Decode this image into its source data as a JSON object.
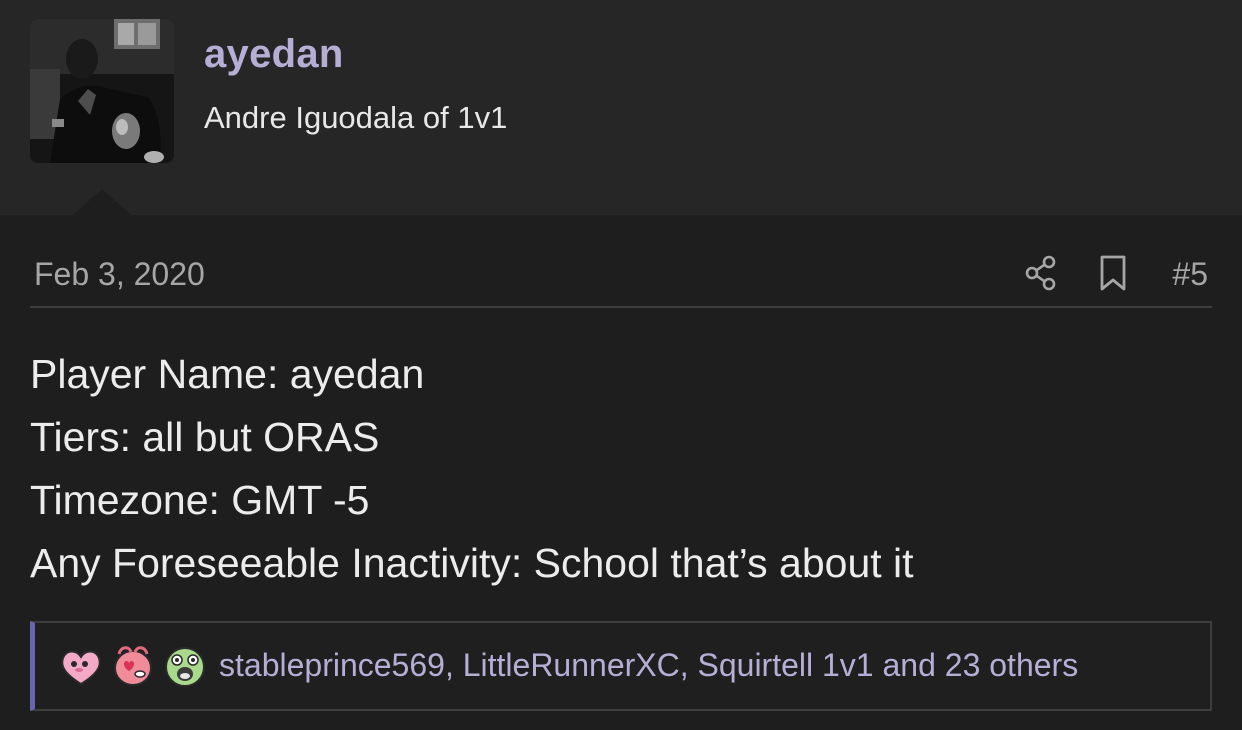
{
  "user": {
    "name": "ayedan",
    "title": "Andre Iguodala of 1v1",
    "avatar_icon": "user-avatar-photo"
  },
  "post": {
    "date": "Feb 3, 2020",
    "number": "#5",
    "share_icon": "share-icon",
    "bookmark_icon": "bookmark-icon",
    "lines": [
      "Player Name: ayedan",
      "Tiers: all but ORAS",
      "Timezone: GMT -5",
      "Any Foreseeable Inactivity: School that’s about it"
    ]
  },
  "reactions": {
    "icons": [
      "like-heart-reaction-icon",
      "love-reaction-icon",
      "surprised-reaction-icon"
    ],
    "text": "stableprince569, LittleRunnerXC, Squirtell 1v1 and 23 others"
  },
  "colors": {
    "accent": "#b7aed6",
    "background": "#1e1e1e",
    "header_background": "#262627",
    "reactions_bar_accent": "#6a65b0"
  }
}
